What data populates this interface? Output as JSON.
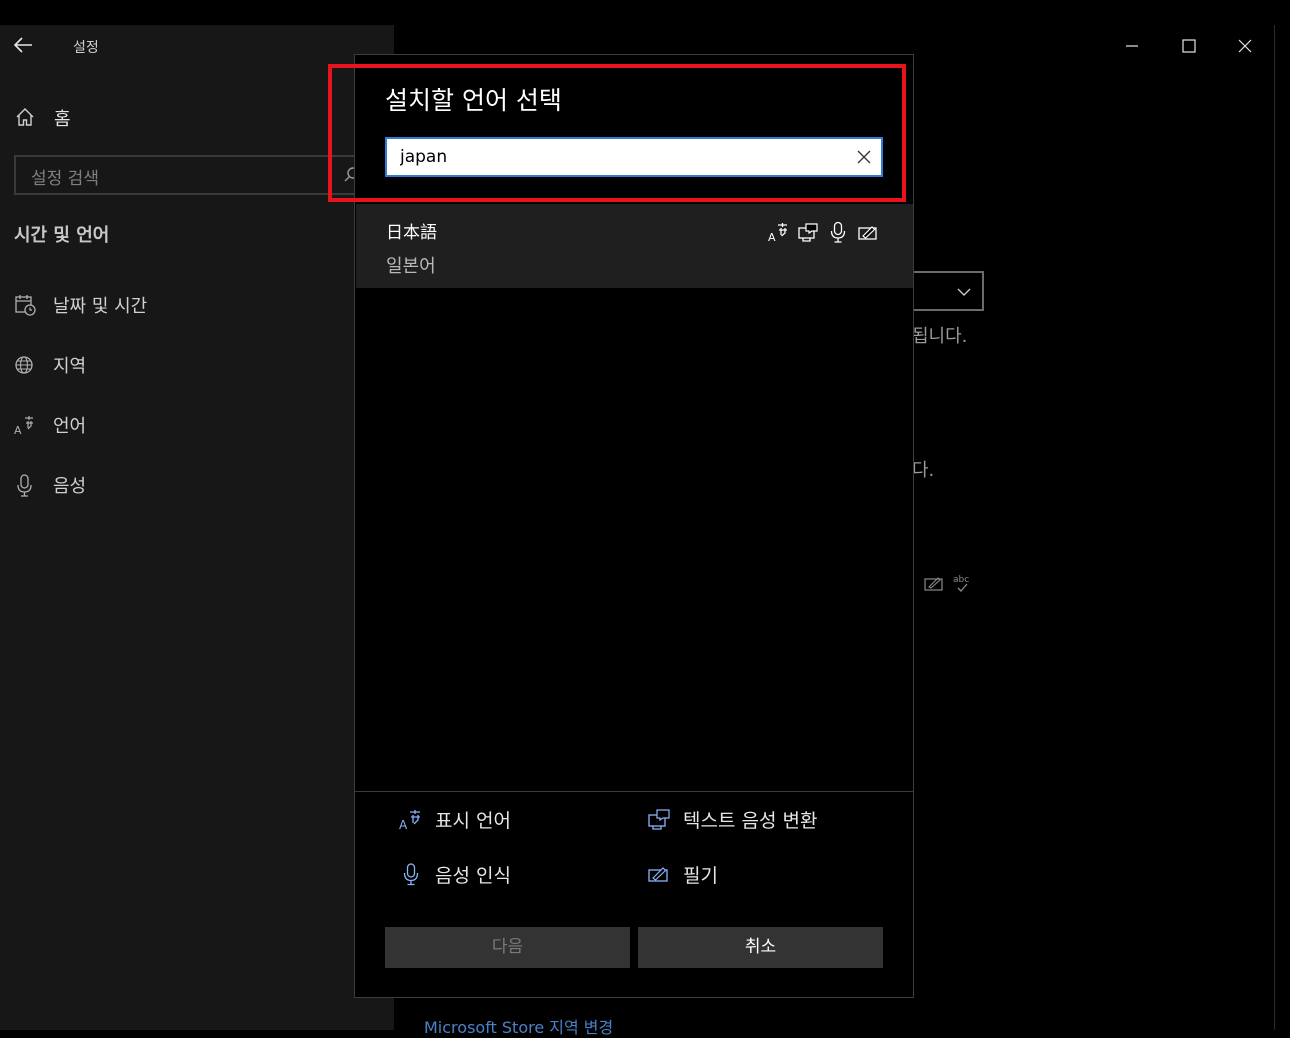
{
  "app": {
    "title": "설정"
  },
  "sidebar": {
    "home_label": "홈",
    "search_placeholder": "설정 검색",
    "section_title": "시간 및 언어",
    "items": [
      {
        "label": "날짜 및 시간",
        "icon": "calendar-clock-icon"
      },
      {
        "label": "지역",
        "icon": "globe-icon"
      },
      {
        "label": "언어",
        "icon": "language-icon"
      },
      {
        "label": "음성",
        "icon": "microphone-icon"
      }
    ]
  },
  "background": {
    "text_1": "됩니다.",
    "text_2": "다.",
    "link": "Microsoft Store 지역 변경"
  },
  "dialog": {
    "title": "설치할 언어 선택",
    "search_value": "japan",
    "results": [
      {
        "native_name": "日本語",
        "localized_name": "일본어",
        "features": [
          "display-language-icon",
          "text-to-speech-icon",
          "speech-recognition-icon",
          "handwriting-icon"
        ]
      }
    ],
    "legend": [
      {
        "label": "표시 언어",
        "icon": "display-language-icon"
      },
      {
        "label": "텍스트 음성 변환",
        "icon": "text-to-speech-icon"
      },
      {
        "label": "음성 인식",
        "icon": "speech-recognition-icon"
      },
      {
        "label": "필기",
        "icon": "handwriting-icon"
      }
    ],
    "next_label": "다음",
    "cancel_label": "취소"
  },
  "colors": {
    "accent": "#2f7bd8",
    "highlight": "#e8141b",
    "icon_blue": "#8ab4f8"
  }
}
